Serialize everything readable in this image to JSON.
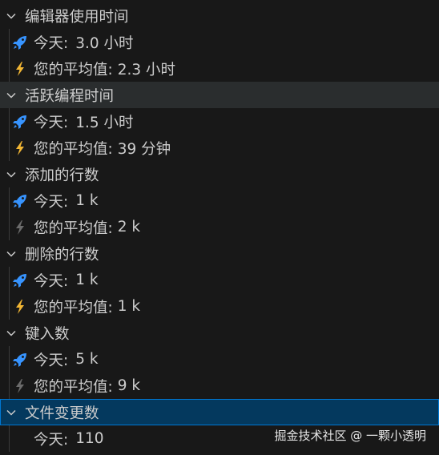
{
  "sections": [
    {
      "title": "编辑器使用时间",
      "today_label": "今天:",
      "today_value": "3.0 小时",
      "avg_label": "您的平均值:",
      "avg_value": "2.3 小时",
      "avg_icon": "lightning-icon",
      "avg_icon_color": "#f2b634"
    },
    {
      "title": "活跃编程时间",
      "today_label": "今天:",
      "today_value": "1.5 小时",
      "avg_label": "您的平均值:",
      "avg_value": "39 分钟",
      "avg_icon": "lightning-icon",
      "avg_icon_color": "#f2b634"
    },
    {
      "title": "添加的行数",
      "today_label": "今天:",
      "today_value": "1 k",
      "avg_label": "您的平均值:",
      "avg_value": "2 k",
      "avg_icon": "lightning-icon",
      "avg_icon_color": "#6b6b6b"
    },
    {
      "title": "删除的行数",
      "today_label": "今天:",
      "today_value": "1 k",
      "avg_label": "您的平均值:",
      "avg_value": "1 k",
      "avg_icon": "lightning-icon",
      "avg_icon_color": "#f2b634"
    },
    {
      "title": "键入数",
      "today_label": "今天:",
      "today_value": "5 k",
      "avg_label": "您的平均值:",
      "avg_value": "9 k",
      "avg_icon": "lightning-icon",
      "avg_icon_color": "#6b6b6b"
    },
    {
      "title": "文件变更数",
      "today_label": "今天:",
      "today_value": "110"
    }
  ],
  "colors": {
    "background": "#181818",
    "rocket": "#3794ff",
    "lightning_active": "#f2b634",
    "lightning_inactive": "#6b6b6b",
    "selected_row": "#04395e",
    "selected_border": "#0078d4"
  },
  "watermark": "掘金技术社区 @ 一颗小透明"
}
